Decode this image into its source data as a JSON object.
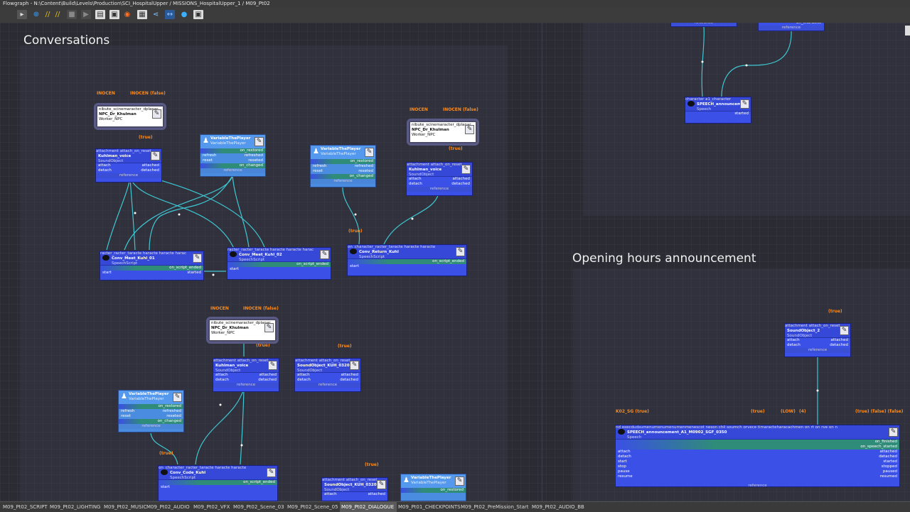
{
  "window": {
    "title": "Flowgraph - N:\\Content\\Build\\Levels\\Production\\SCI_HospitalUpper / MISSIONS_HospitalUpper_1 / M09_Pt02"
  },
  "toolbar": {
    "icons": [
      "pointer-icon",
      "add-icon",
      "align-icon",
      "align-icon",
      "debug-icon",
      "play-icon",
      "step-icon",
      "save-icon",
      "save-as-icon",
      "eye-icon",
      "grid-icon",
      "share-icon",
      "link-icon",
      "globe-icon",
      "export-icon"
    ]
  },
  "groups": {
    "conversations": "Conversations",
    "opening": "Opening hours announcement"
  },
  "labels": {
    "inocen": "INOCEN",
    "inocen_false": "INOCEN (false)",
    "true": "(true)",
    "k02": "K02_SG (true)",
    "low": "(LOW)",
    "four": "(4)",
    "true_false_false": "(true)  (false)  (false)"
  },
  "entities": {
    "e1": {
      "ports": "nibute_scinemaracter_dplanar",
      "name": "NPC_Dr_Khulman",
      "type": "Worker_NPC",
      "ref": "npc_reference"
    },
    "e2": {
      "ports": "nibute_scinemaracter_dplanar",
      "name": "NPC_Dr_Khulman",
      "type": "Worker_NPC",
      "ref": "npc_reference"
    },
    "e3": {
      "ports": "nibute_scinemaracter_dplanar",
      "name": "NPC_Dr_Khulman",
      "type": "Worker_NPC",
      "ref": "npc_reference"
    }
  },
  "sound_nodes": {
    "s1": {
      "ports": "attachment   attach_on_reset",
      "name": "Kuhlman_voice",
      "type": "SoundObject",
      "rows": [
        [
          "attach",
          "attached"
        ],
        [
          "detach",
          "detached"
        ]
      ],
      "ref": "reference"
    },
    "s2": {
      "ports": "attachment   attach_on_reset",
      "name": "Kuhlman_voice",
      "type": "SoundObject",
      "rows": [
        [
          "attach",
          "attached"
        ],
        [
          "detach",
          "detached"
        ]
      ],
      "ref": "reference"
    },
    "s3": {
      "ports": "attachment   attach_on_reset",
      "name": "Kuhlman_voice",
      "type": "SoundObject",
      "rows": [
        [
          "attach",
          "attached"
        ],
        [
          "detach",
          "detached"
        ]
      ],
      "ref": "reference"
    },
    "s4": {
      "ports": "attachment   attach_on_reset",
      "name": "SoundObject_KUH_0320",
      "type": "SoundObject",
      "rows": [
        [
          "attach",
          "attached"
        ],
        [
          "detach",
          "detached"
        ]
      ],
      "ref": "reference"
    },
    "s5": {
      "ports": "attachment   attach_on_reset",
      "name": "SoundObject_KUH_0320",
      "type": "SoundObject",
      "rows": [
        [
          "attach",
          "attached"
        ],
        [
          "detach",
          "detached"
        ]
      ],
      "ref": ""
    },
    "s6": {
      "ports": "attachment   attach_on_reset",
      "name": "SoundObject_2",
      "type": "SoundObject",
      "rows": [
        [
          "attach",
          "attached"
        ],
        [
          "detach",
          "detached"
        ]
      ],
      "ref": "reference"
    }
  },
  "var_nodes": {
    "v1": {
      "name": "VariableThePlayer",
      "type": "VariableThePlayer",
      "rows": [
        [
          "",
          "on_restored"
        ],
        [
          "refresh",
          "refreshed"
        ],
        [
          "reset",
          "reseted"
        ],
        [
          "",
          "on_changed"
        ]
      ],
      "ref": "reference"
    },
    "v2": {
      "name": "VariableThePlayer",
      "type": "VariableThePlayer",
      "rows": [
        [
          "",
          "on_restored"
        ],
        [
          "refresh",
          "refreshed"
        ],
        [
          "reset",
          "reseted"
        ],
        [
          "",
          "on_changed"
        ]
      ],
      "ref": "reference"
    },
    "v3": {
      "name": "VariableThePlayer",
      "type": "VariableThePlayer",
      "rows": [
        [
          "",
          "on_restored"
        ],
        [
          "refresh",
          "refreshed"
        ],
        [
          "reset",
          "reseted"
        ],
        [
          "",
          "on_changed"
        ]
      ],
      "ref": "reference"
    },
    "v4": {
      "name": "VariableThePlayer",
      "type": "VariableThePlayer",
      "rows": [
        [
          "",
          "on_restored"
        ]
      ],
      "ref": ""
    }
  },
  "script_nodes": {
    "c1": {
      "ports": "racter_racter_taracte haracte haracte harac",
      "name": "Conv_Meet_Kuhl_01",
      "type": "SpeechScript",
      "rows": [
        [
          "",
          "on_script_ended"
        ],
        [
          "start",
          "started"
        ]
      ]
    },
    "c2": {
      "ports": "racter_racter_taracte haracte haracte harac",
      "name": "Conv_Meet_Kuhl_02",
      "type": "SpeechScript",
      "rows": [
        [
          "",
          "on_script_ended"
        ],
        [
          "start",
          ""
        ]
      ]
    },
    "c3": {
      "ports": "on_character_racter_taracte haracte haracte",
      "name": "Conv_Return_Kuhl",
      "type": "SpeechScript",
      "rows": [
        [
          "",
          "on_script_ended"
        ],
        [
          "start",
          ""
        ]
      ]
    },
    "c4": {
      "ports": "on_character_racter_taracte haracte haracte",
      "name": "Conv_Code_Kuhl",
      "type": "SpeechScript",
      "rows": [
        [
          "",
          "on_script_ended"
        ],
        [
          "start",
          ""
        ]
      ]
    }
  },
  "speech_small": {
    "ports": "character   a1_character",
    "name": "SPEECH_announcement",
    "type": "Speech",
    "rows": [
      [
        "",
        "started"
      ]
    ]
  },
  "speech_big": {
    "ports": "nd  execdudsumenumenumenumenmenescot  neson  chil  soumch  orvece  timaracteharacachmen  on  rt  on  rve  on  n",
    "name": "SPEECH_announcement_A1_M0902_SGF_0350",
    "type": "Speech",
    "rows": [
      [
        "",
        "on_finished"
      ],
      [
        "",
        "on_speech_started"
      ],
      [
        "attach",
        "attached"
      ],
      [
        "detach",
        "detached"
      ],
      [
        "start",
        "started"
      ],
      [
        "stop",
        "stopped"
      ],
      [
        "pause",
        "paused"
      ],
      [
        "resume",
        "resumed"
      ]
    ],
    "ref": "reference"
  },
  "top_nodes": {
    "n1": "reference",
    "n2": "on_character",
    "n3": "reference"
  },
  "tabs": [
    {
      "label": "M09_Pt02_SCRIPT",
      "active": false
    },
    {
      "label": "M09_Pt02_LIGHTING",
      "active": false
    },
    {
      "label": "M09_Pt02_MUSIC",
      "active": false
    },
    {
      "label": "M09_Pt02_AUDIO",
      "active": false
    },
    {
      "label": "M09_Pt02_VFX",
      "active": false
    },
    {
      "label": "M09_Pt02_Scene_03",
      "active": false
    },
    {
      "label": "M09_Pt02_Scene_05",
      "active": false
    },
    {
      "label": "M09_Pt02_DIALOGUE",
      "active": true
    },
    {
      "label": "M09_Pt01_CHECKPOINTS",
      "active": false
    },
    {
      "label": "M09_Pt02_PreMission_Start",
      "active": false
    },
    {
      "label": "M09_Pt02_AUDIO_BB",
      "active": false
    }
  ],
  "colors": {
    "wire": "#3ec8d4",
    "node": "#3a50e6",
    "accent_label": "#ff8c1a",
    "green_row": "#2f8c78"
  }
}
